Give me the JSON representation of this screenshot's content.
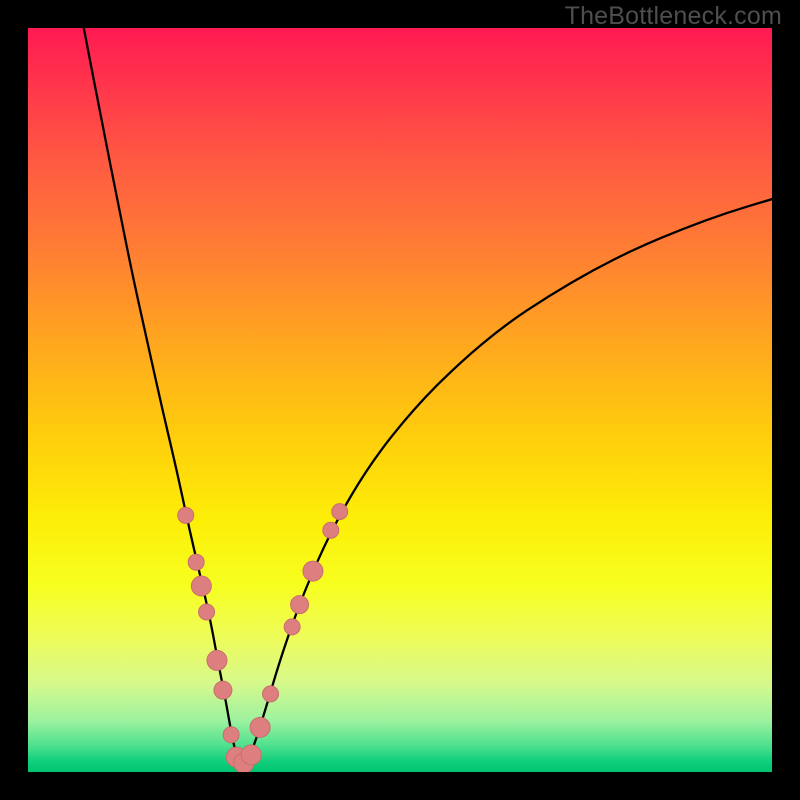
{
  "watermark": "TheBottleneck.com",
  "colors": {
    "frame": "#000000",
    "curve": "#000000",
    "dot_fill": "#dd7f7e",
    "dot_stroke": "#c86e6d"
  },
  "chart_data": {
    "type": "line",
    "title": "",
    "xlabel": "",
    "ylabel": "",
    "xlim": [
      0,
      100
    ],
    "ylim": [
      0,
      100
    ],
    "grid": false,
    "series": [
      {
        "name": "bottleneck-curve",
        "x_percent": [
          7.5,
          10,
          12,
          14,
          16,
          18,
          20,
          21.5,
          23,
          24.5,
          25.5,
          26.5,
          27.2,
          27.8,
          28.4,
          29.2,
          30.2,
          31.8,
          34,
          37,
          41,
          46,
          52,
          58,
          64,
          70,
          76,
          82,
          88,
          94,
          100
        ],
        "y_percent": [
          100,
          87,
          77,
          67,
          58,
          49,
          40.5,
          33.5,
          27,
          20.5,
          15,
          10,
          6,
          3,
          1.2,
          1.2,
          3,
          8,
          15.5,
          24,
          33,
          41.5,
          49,
          55,
          60,
          64,
          67.5,
          70.5,
          73,
          75.2,
          77
        ]
      }
    ],
    "annotations": {
      "dots": [
        {
          "x_percent": 21.2,
          "y_percent": 34.5,
          "r": 8
        },
        {
          "x_percent": 22.6,
          "y_percent": 28.2,
          "r": 8
        },
        {
          "x_percent": 23.3,
          "y_percent": 25.0,
          "r": 10
        },
        {
          "x_percent": 24.0,
          "y_percent": 21.5,
          "r": 8
        },
        {
          "x_percent": 25.4,
          "y_percent": 15.0,
          "r": 10
        },
        {
          "x_percent": 26.2,
          "y_percent": 11.0,
          "r": 9
        },
        {
          "x_percent": 27.3,
          "y_percent": 5.0,
          "r": 8
        },
        {
          "x_percent": 28.0,
          "y_percent": 2.0,
          "r": 10
        },
        {
          "x_percent": 29.0,
          "y_percent": 1.2,
          "r": 10
        },
        {
          "x_percent": 30.0,
          "y_percent": 2.3,
          "r": 10
        },
        {
          "x_percent": 31.2,
          "y_percent": 6.0,
          "r": 10
        },
        {
          "x_percent": 32.6,
          "y_percent": 10.5,
          "r": 8
        },
        {
          "x_percent": 35.5,
          "y_percent": 19.5,
          "r": 8
        },
        {
          "x_percent": 36.5,
          "y_percent": 22.5,
          "r": 9
        },
        {
          "x_percent": 38.3,
          "y_percent": 27.0,
          "r": 10
        },
        {
          "x_percent": 40.7,
          "y_percent": 32.5,
          "r": 8
        },
        {
          "x_percent": 41.9,
          "y_percent": 35.0,
          "r": 8
        }
      ]
    }
  }
}
